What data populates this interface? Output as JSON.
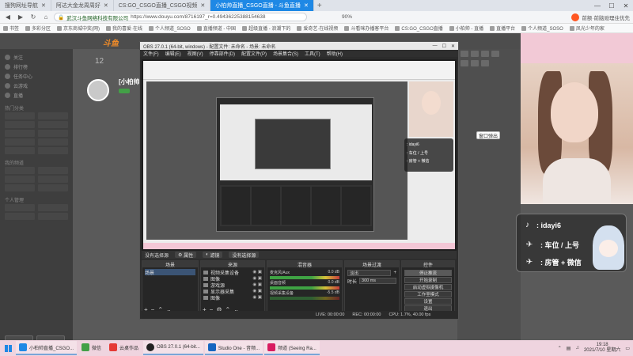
{
  "browser": {
    "tabs": [
      {
        "label": "搜狗网址导航",
        "active": false
      },
      {
        "label": "阿达大金龙周周好",
        "active": false
      },
      {
        "label": "CS:GO_CSGO直播_CSGO视频",
        "active": false
      },
      {
        "label": "小柏帅直播_CSGO直播 - 斗鱼直播",
        "active": true
      }
    ],
    "new_tab": "+",
    "win_controls": [
      "—",
      "☐",
      "✕"
    ],
    "url_site": "武汉斗鱼网络科技有限公司",
    "url_path": "https://www.douyu.com/8716197_r=0.49436225388154638",
    "zoom": "90%",
    "rec_text": "前额·前脑勋理住优先",
    "bookmarks": [
      "书签",
      "多彩分区",
      "京东商城中奖(网)",
      "我的喜爱·在线",
      "个人频道_SOSO",
      "直播频道 - 中国",
      "超级直播 - 浪潮下的",
      "爱奇艺·在线视频",
      "斗看咪办播客平台",
      "CS:GO_CSGO直播",
      "小柏帅 - 直播",
      "直播平台",
      "个人频道_SOSO",
      "凤光少年的家"
    ]
  },
  "web": {
    "logo": "斗鱼",
    "sidebar": {
      "items": [
        "关注",
        "排行榜",
        "任务中心",
        "云游戏",
        "直播"
      ],
      "section": "热门分类",
      "section2": "我的频道",
      "section3": "个人管理"
    },
    "streamer": {
      "count": "12",
      "name": "[小柏帅"
    },
    "popup_btn": "窗口弹出",
    "overlay": {
      "handle": ": idayi6",
      "line1": ": 车位 / 上号",
      "line2": ": 房管 + 微信"
    }
  },
  "obs": {
    "title": "OBS 27.0.1 (64-bit, windows) - 配置文件: 未命名 - 场景: 未命名",
    "menu": [
      "文件(F)",
      "编辑(E)",
      "视图(V)",
      "停靠部件(D)",
      "配置文件(P)",
      "场景集合(S)",
      "工具(T)",
      "帮助(H)"
    ],
    "selection_bar": {
      "label": "没有选择源",
      "props": "属性",
      "filters": "滤镜",
      "no_source": "没有选择源"
    },
    "scenes": {
      "header": "场景",
      "items": [
        "场景"
      ]
    },
    "sources": {
      "header": "来源",
      "items": [
        "视频采集设备",
        "图像",
        "游戏源",
        "显示器采集",
        "图像"
      ]
    },
    "mixer": {
      "header": "混音器",
      "tracks": [
        {
          "name": "麦克风/Aux",
          "db": "0.0 dB"
        },
        {
          "name": "桌面音频",
          "db": "0.0 dB"
        },
        {
          "name": "视频采集设备",
          "db": "-5.5 dB"
        }
      ]
    },
    "transitions": {
      "header": "场景过渡",
      "type": "淡出",
      "duration_label": "时长",
      "duration": "300 ms"
    },
    "controls": {
      "header": "控件",
      "buttons": [
        "停止推流",
        "开始录制",
        "启动虚拟摄像机",
        "工作室模式",
        "设置",
        "退出"
      ]
    },
    "status": {
      "live": "LIVE: 00:00:00",
      "rec": "REC: 00:00:00",
      "cpu": "CPU: 1.7%, 40.00 fps"
    }
  },
  "taskbar": {
    "items": [
      "小柏帅直播_CSGO...",
      "微信",
      "云桌作品",
      "OBS 27.0.1 (64-bit...",
      "Studio One - 音频...",
      "频道 (Seeing Ra..."
    ],
    "time": "19:18",
    "date": "2021/7/10 星期六"
  },
  "colors": {
    "active_tab": "#1e88e5",
    "brand_orange": "#f28c28",
    "taskbar_pink": "#efd4df"
  }
}
